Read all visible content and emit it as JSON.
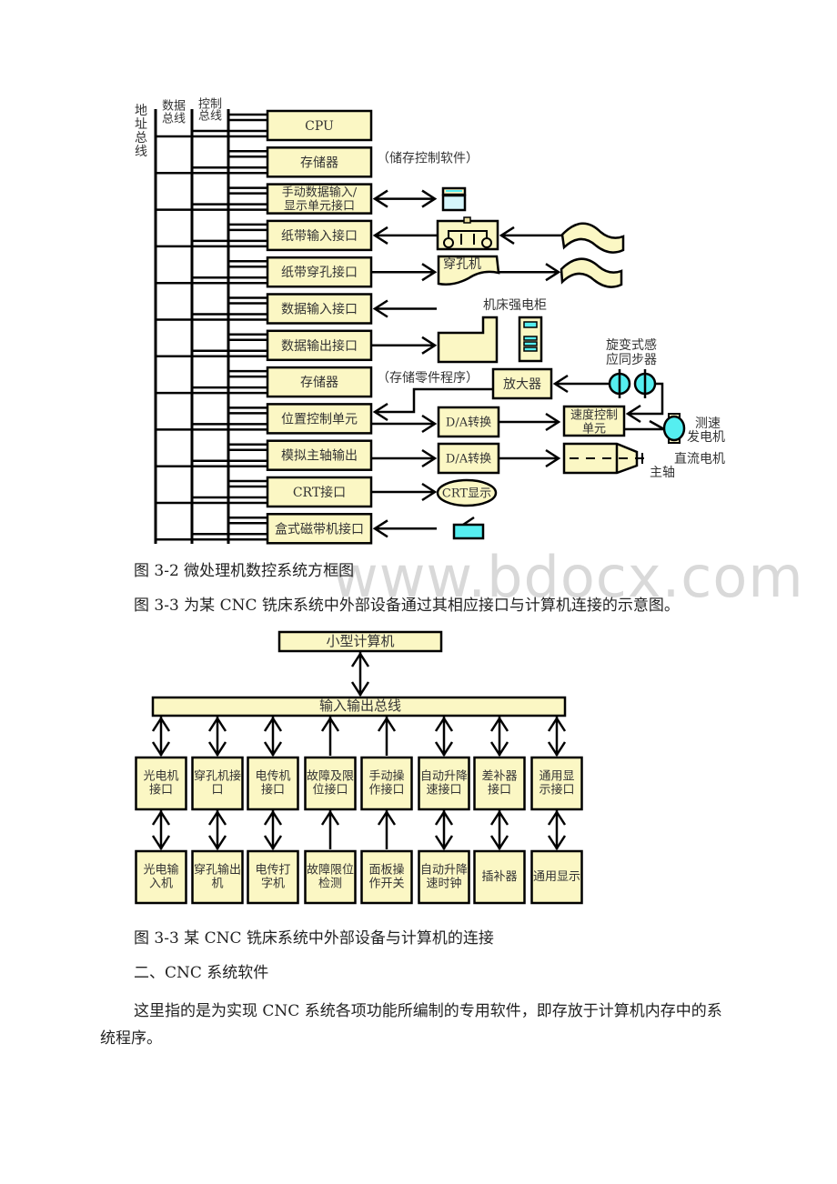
{
  "watermark": "www.bdocx.com",
  "figure_3_2": {
    "bus_labels": {
      "address": "地址总线",
      "data": "数据总线",
      "control": "控制总线"
    },
    "blocks": [
      {
        "label": "CPU",
        "lines": [
          "CPU"
        ]
      },
      {
        "label": "存储器",
        "lines": [
          "存储器"
        ],
        "note": "（储存控制软件）"
      },
      {
        "label": "手动数据输入/显示单元接口",
        "lines": [
          "手动数据输入/",
          "显示单元接口"
        ]
      },
      {
        "label": "纸带输入接口",
        "lines": [
          "纸带输入接口"
        ]
      },
      {
        "label": "纸带穿孔接口",
        "lines": [
          "纸带穿孔接口"
        ]
      },
      {
        "label": "数据输入接口",
        "lines": [
          "数据输入接口"
        ]
      },
      {
        "label": "数据输出接口",
        "lines": [
          "数据输出接口"
        ]
      },
      {
        "label": "存储器",
        "lines": [
          "存储器"
        ],
        "note": "（存储零件程序）"
      },
      {
        "label": "位置控制单元",
        "lines": [
          "位置控制单元"
        ]
      },
      {
        "label": "模拟主轴输出",
        "lines": [
          "模拟主轴输出"
        ]
      },
      {
        "label": "CRT接口",
        "lines": [
          "CRT接口"
        ]
      },
      {
        "label": "盒式磁带机接口",
        "lines": [
          "盒式磁带机接口"
        ]
      }
    ],
    "devices": {
      "punch": "穿孔机",
      "cabinet": "机床强电柜",
      "amplifier": "放大器",
      "resolver": [
        "旋变式感",
        "应同步器"
      ],
      "da1": "D/A转换",
      "da2": "D/A转换",
      "speed_ctrl": [
        "速度控制",
        "单元"
      ],
      "tacho": [
        "测速",
        "发电机"
      ],
      "dc_motor": "直流电机",
      "spindle": "主轴",
      "crt": "CRT显示"
    },
    "colors": {
      "block_fill": "#fbf7c4",
      "accent_cyan": "#55eef0",
      "stroke": "#000000"
    }
  },
  "caption_1": "图 3-2 微处理机数控系统方框图",
  "intro_para": "图 3-3 为某 CNC 铣床系统中外部设备通过其相应接口与计算机连接的示意图。",
  "figure_3_3": {
    "computer": "小型计算机",
    "bus": "输入输出总线",
    "columns": [
      {
        "interface": [
          "光电机",
          "接口"
        ],
        "device": [
          "光电输",
          "入机"
        ],
        "bus_link": "both",
        "dev_link": "both"
      },
      {
        "interface": [
          "穿孔机接",
          "口"
        ],
        "device": [
          "穿孔输出",
          "机"
        ],
        "bus_link": "both",
        "dev_link": "both"
      },
      {
        "interface": [
          "电传机",
          "接口"
        ],
        "device": [
          "电传打",
          "字机"
        ],
        "bus_link": "both",
        "dev_link": "both"
      },
      {
        "interface": [
          "故障及限",
          "位接口"
        ],
        "device": [
          "故障限位",
          "检测"
        ],
        "bus_link": "up",
        "dev_link": "up"
      },
      {
        "interface": [
          "手动操",
          "作接口"
        ],
        "device": [
          "面板操",
          "作开关"
        ],
        "bus_link": "up",
        "dev_link": "up"
      },
      {
        "interface": [
          "自动升降",
          "速接口"
        ],
        "device": [
          "自动升降",
          "速时钟"
        ],
        "bus_link": "both",
        "dev_link": "both"
      },
      {
        "interface": [
          "差补器",
          "接口"
        ],
        "device": [
          "插补器"
        ],
        "bus_link": "both",
        "dev_link": "both"
      },
      {
        "interface": [
          "通用显",
          "示接口"
        ],
        "device": [
          "通用显示"
        ],
        "bus_link": "both",
        "dev_link": "both"
      }
    ]
  },
  "caption_2": "图 3-3 某 CNC 铣床系统中外部设备与计算机的连接",
  "section_heading": "二、CNC 系统软件",
  "body_para": "这里指的是为实现 CNC 系统各项功能所编制的专用软件，即存放于计算机内存中的系统程序。"
}
